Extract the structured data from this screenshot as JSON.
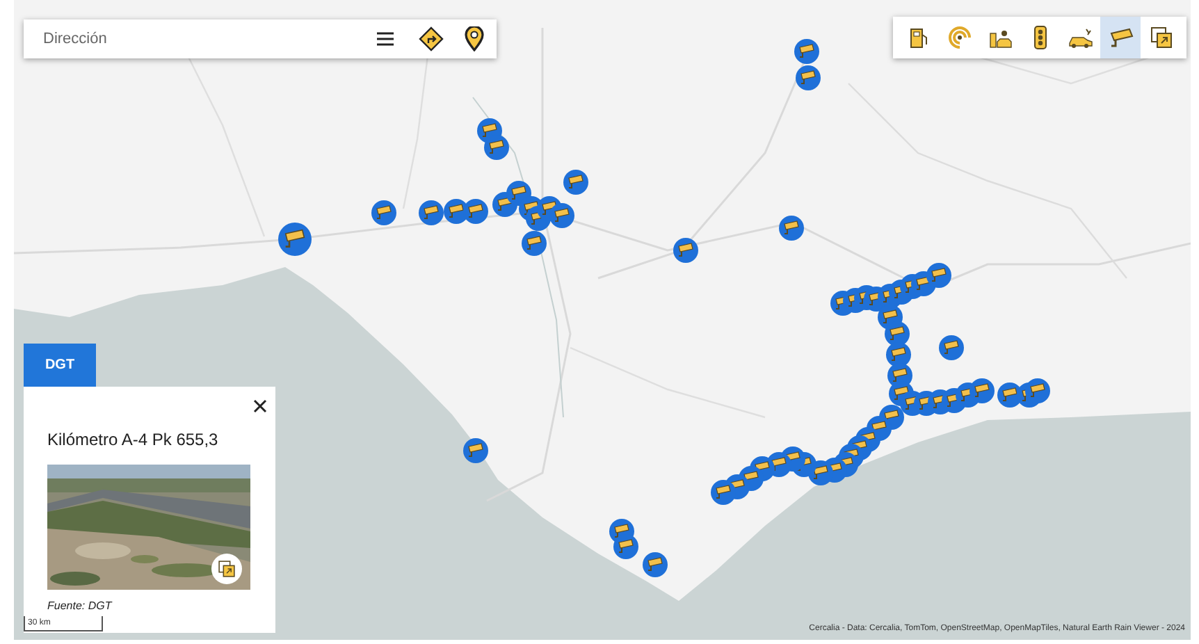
{
  "search": {
    "placeholder": "Dirección"
  },
  "layer_toolbar": [
    {
      "kind": "fuel",
      "selected": false
    },
    {
      "kind": "radar",
      "selected": false
    },
    {
      "kind": "charging",
      "selected": false
    },
    {
      "kind": "traffic-light",
      "selected": false
    },
    {
      "kind": "incident",
      "selected": false
    },
    {
      "kind": "camera",
      "selected": true
    },
    {
      "kind": "fullscreen",
      "selected": false
    }
  ],
  "source_tab": {
    "label": "DGT"
  },
  "popup": {
    "title": "Kilómetro A-4 Pk 655,3",
    "source": "Fuente: DGT"
  },
  "scale": {
    "label": "30 km"
  },
  "attribution": "Cercalia - Data: Cercalia, TomTom, OpenStreetMap, OpenMapTiles, Natural Earth Rain Viewer - 2024"
}
